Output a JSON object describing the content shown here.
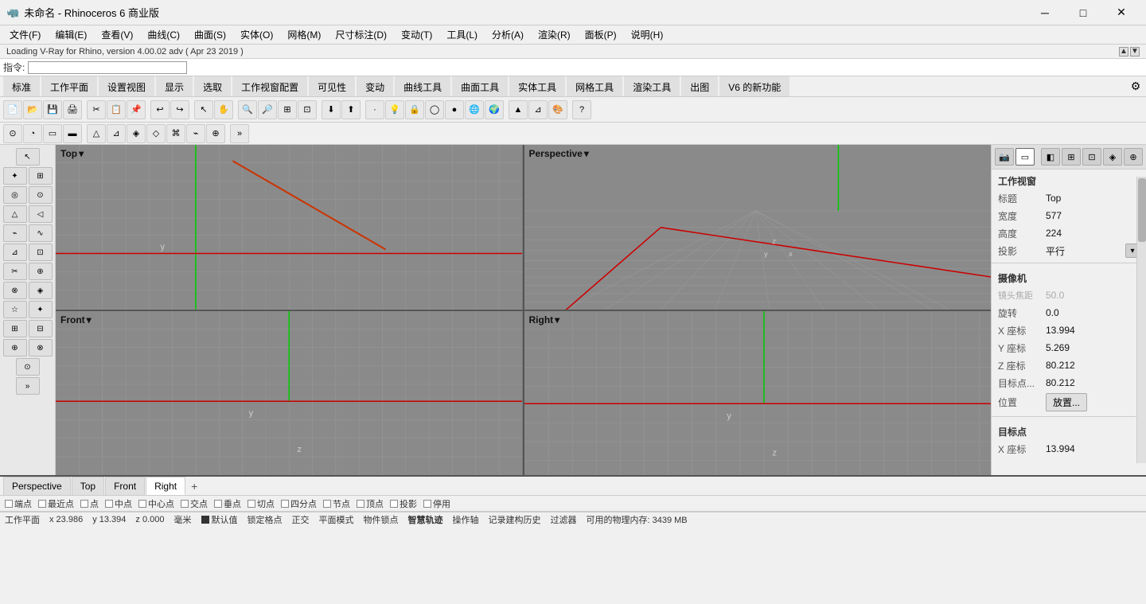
{
  "titleBar": {
    "title": "未命名 - Rhinoceros 6 商业版",
    "minBtn": "─",
    "maxBtn": "□",
    "closeBtn": "✕"
  },
  "menuBar": {
    "items": [
      "文件(F)",
      "编辑(E)",
      "查看(V)",
      "曲线(C)",
      "曲面(S)",
      "实体(O)",
      "网格(M)",
      "尺寸标注(D)",
      "变动(T)",
      "工具(L)",
      "分析(A)",
      "渲染(R)",
      "面板(P)",
      "说明(H)"
    ]
  },
  "loadingBar": {
    "message": "Loading V-Ray for Rhino, version 4.00.02 adv ( Apr 23 2019 )"
  },
  "commandBar": {
    "label": "指令:",
    "placeholder": ""
  },
  "tabsBar": {
    "tabs": [
      "标准",
      "工作平面",
      "设置视图",
      "显示",
      "选取",
      "工作视窗配置",
      "可见性",
      "变动",
      "曲线工具",
      "曲面工具",
      "实体工具",
      "网格工具",
      "渲染工具",
      "出图",
      "V6 的新功能"
    ]
  },
  "viewports": {
    "topLeft": {
      "label": "Top",
      "arrow": "▾"
    },
    "topRight": {
      "label": "Perspective",
      "arrow": "▾"
    },
    "bottomLeft": {
      "label": "Front",
      "arrow": "▾"
    },
    "bottomRight": {
      "label": "Right",
      "arrow": "▾"
    }
  },
  "rightPanel": {
    "sectionWorkView": "工作视窗",
    "rows": [
      {
        "label": "标题",
        "value": "Top"
      },
      {
        "label": "宽度",
        "value": "577"
      },
      {
        "label": "高度",
        "value": "224"
      },
      {
        "label": "投影",
        "value": "平行"
      }
    ],
    "sectionCamera": "摄像机",
    "cameraRows": [
      {
        "label": "镜头焦距",
        "value": "50.0",
        "grayed": true
      },
      {
        "label": "旋转",
        "value": "0.0"
      },
      {
        "label": "X 座标",
        "value": "13.994"
      },
      {
        "label": "Y 座标",
        "value": "5.269"
      },
      {
        "label": "Z 座标",
        "value": "80.212"
      },
      {
        "label": "目标点...",
        "value": "80.212"
      }
    ],
    "positionLabel": "位置",
    "positionBtn": "放置...",
    "sectionTarget": "目标点",
    "targetRows": [
      {
        "label": "X 座标",
        "value": "13.994"
      }
    ]
  },
  "bottomTabs": {
    "tabs": [
      "Perspective",
      "Top",
      "Front",
      "Right"
    ],
    "activeTab": "Right",
    "addBtn": "+"
  },
  "snapBar": {
    "items": [
      "端点",
      "最近点",
      "点",
      "中点",
      "中心点",
      "交点",
      "垂点",
      "切点",
      "四分点",
      "节点",
      "顶点",
      "投影",
      "停用"
    ]
  },
  "statusBar": {
    "workplane": "工作平面",
    "x": "x 23.986",
    "y": "y 13.394",
    "z": "z 0.000",
    "unit": "毫米",
    "dotLabel": "默认值",
    "items": [
      "锁定格点",
      "正交",
      "平面模式",
      "物件锁点",
      "智慧轨迹",
      "操作轴",
      "记录建构历史",
      "过滤器",
      "可用的物理内存: 3439 MB"
    ]
  }
}
